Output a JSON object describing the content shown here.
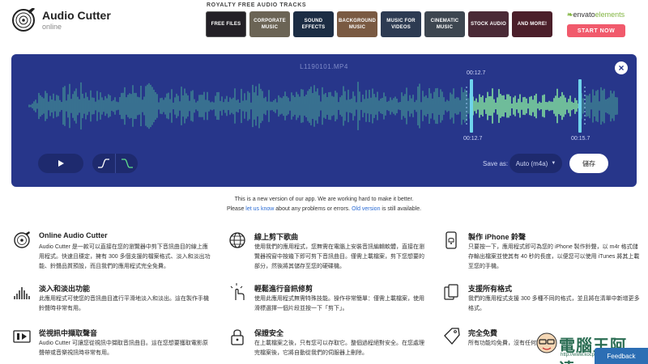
{
  "app": {
    "title": "Audio Cutter",
    "status": "online"
  },
  "ad": {
    "heading": "ROYALTY FREE AUDIO TRACKS",
    "tiles": [
      {
        "label": "FREE FILES",
        "color": "#232026"
      },
      {
        "label": "CORPORATE MUSIC",
        "color": "#6b6455"
      },
      {
        "label": "SOUND EFFECTS",
        "color": "#1c2d44"
      },
      {
        "label": "BACKGROUND MUSIC",
        "color": "#7a5a42"
      },
      {
        "label": "MUSIC FOR VIDEOS",
        "color": "#2d3b52"
      },
      {
        "label": "CINEMATIC MUSIC",
        "color": "#3d4650"
      },
      {
        "label": "STOCK AUDIO",
        "color": "#4a2a36"
      },
      {
        "label": "AND MORE!",
        "color": "#4b1f2a"
      }
    ],
    "brand": "envato",
    "brand_suffix": "elements",
    "cta": "START NOW"
  },
  "editor": {
    "filename": "L1190101.MP4",
    "selection_start_top": "00:12.7",
    "selection_start": "00:12.7",
    "selection_end": "00:15.7",
    "save_as_label": "Save as:",
    "format": "Auto (m4a)",
    "save_button": "儲存",
    "colors": {
      "bg": "#27368a",
      "wave": "#3f8a92",
      "selected_wave": "#8ef5a0",
      "handle": "#6fd4ec"
    }
  },
  "notice": {
    "line1": "This is a new version of our app. We are working hard to make it better.",
    "please": "Please",
    "let_us_know": "let us know",
    "mid": "about any problems or errors.",
    "old_version": "Old version",
    "end": "is still available."
  },
  "features": [
    {
      "icon": "vinyl-record-icon",
      "title": "Online Audio Cutter",
      "desc": "Audio Cutter 是一款可以直接在您的瀏覽器中剪下音訊曲目的線上應用程式。快速且穩定，擁有 300 多個支援的檔案格式、淡入和淡出功能、鈴聲品質預設，而且我們的應用程式完全免費。"
    },
    {
      "icon": "globe-icon",
      "title": "線上剪下歌曲",
      "desc": "使用我們的應用程式，您無需在電腦上安裝音訊編輯軟體，直接在瀏覽器視窗中按幾下即可剪下音訊曲目。僅需上載檔案，剪下您想要的部分，然後將其儲存至您的硬碟機。"
    },
    {
      "icon": "phone-bell-icon",
      "title": "製作 iPhone 鈴聲",
      "desc": "只要按一下，應用程式即可為您的 iPhone 製作鈴聲，以 m4r 格式儲存輸出檔案並使其有 40 秒的長度，以便您可以使用 iTunes 將其上載至您的手機。"
    },
    {
      "icon": "fade-waves-icon",
      "title": "淡入和淡出功能",
      "desc": "此應用程式可使您的音訊曲目進行平滑地淡入和淡出。這在製作手機鈴聲時非常有用。"
    },
    {
      "icon": "touch-hand-icon",
      "title": "輕鬆進行音訊修剪",
      "desc": "使用此應用程式無需特殊技能。操作非常簡單：僅需上載檔案，使用滑標選擇一個片段並按一下「剪下」。"
    },
    {
      "icon": "files-icon",
      "title": "支援所有格式",
      "desc": "我們的應用程式支援 300 多種不同的格式，並且將在清單中新增更多格式。"
    },
    {
      "icon": "video-icon",
      "title": "從視訊中擷取聲音",
      "desc": "Audio Cutter 可讓您從視訊中擷取音訊曲目。這在您想要獲取電影原聲帶或音樂視訊時非常有用。"
    },
    {
      "icon": "lock-icon",
      "title": "保證安全",
      "desc": "在上載檔案之後，只有您可以存取它。整個過程絕對安全。在您處理完檔案後，它將自動從我們的伺服器上刪除。"
    },
    {
      "icon": "free-tag-icon",
      "title": "完全免費",
      "desc": "所有功能均免費，沒有任何限制。"
    }
  ],
  "watermark": {
    "text": "電腦王阿達",
    "url": "http://www.kocpc.com.tw"
  },
  "feedback": "Feedback"
}
